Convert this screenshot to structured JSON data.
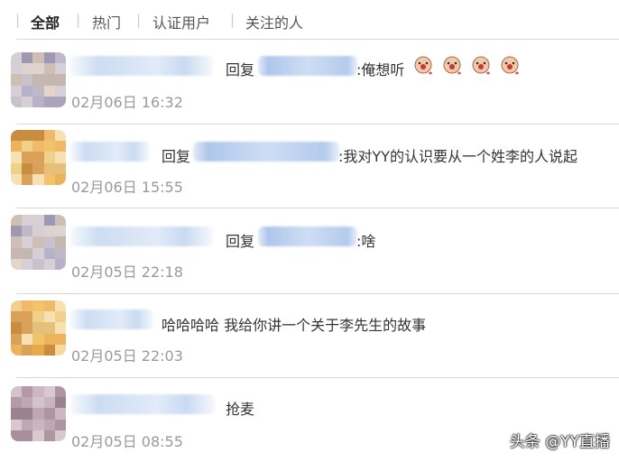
{
  "tabs": [
    {
      "label": "全部",
      "active": true
    },
    {
      "label": "热门",
      "active": false
    },
    {
      "label": "认证用户",
      "active": false
    },
    {
      "label": "关注的人",
      "active": false
    }
  ],
  "comments": [
    {
      "reply_prefix": "回复",
      "text": ":俺想听",
      "time": "02月06日 16:32",
      "emoji": "crying-face-emoji"
    },
    {
      "reply_prefix": "回复",
      "text": ":我对YY的认识要从一个姓李的人说起",
      "time": "02月06日 15:55"
    },
    {
      "reply_prefix": "回复",
      "text": ":啥",
      "time": "02月05日 22:18"
    },
    {
      "text": "哈哈哈哈 我给你讲一个关于李先生的故事",
      "time": "02月05日 22:03"
    },
    {
      "text": "抢麦",
      "time": "02月05日 08:55"
    }
  ],
  "watermark": "头条 @YY直播",
  "colors": {
    "time_text": "#999999",
    "divider": "#d9d9d9",
    "tab_separator": "#cccccc"
  }
}
